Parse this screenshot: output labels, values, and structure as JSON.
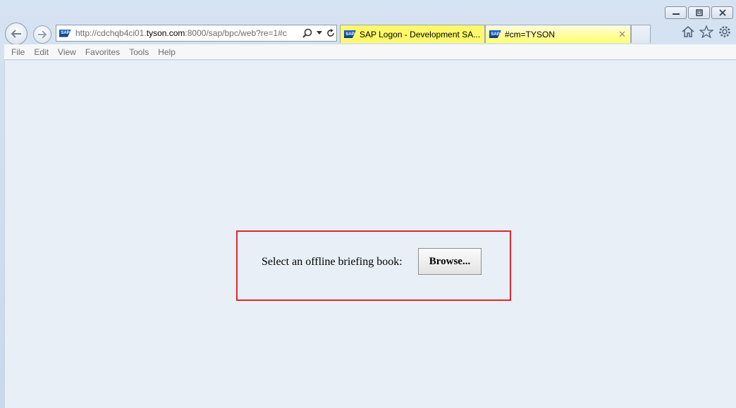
{
  "browser": {
    "address": {
      "prefix": "http://cdchqb4ci01.",
      "host": "tyson.com",
      "suffix": ":8000/sap/bpc/web?re=1#c"
    },
    "tabs": [
      {
        "label": "SAP Logon - Development SA...",
        "active": false
      },
      {
        "label": "#cm=TYSON",
        "active": true,
        "close": "✕"
      }
    ],
    "menu": [
      "File",
      "Edit",
      "View",
      "Favorites",
      "Tools",
      "Help"
    ],
    "icons": [
      "back-icon",
      "forward-icon",
      "search-icon",
      "dropdown-icon",
      "refresh-icon",
      "home-icon",
      "star-icon",
      "gear-icon",
      "minimize-icon",
      "restore-icon",
      "close-icon"
    ]
  },
  "page": {
    "prompt": "Select an offline briefing book:",
    "browse_label": "Browse..."
  },
  "colors": {
    "highlight": "#e0262d",
    "tab_yellow": "#fff96a",
    "content_bg": "#e9eff6"
  }
}
